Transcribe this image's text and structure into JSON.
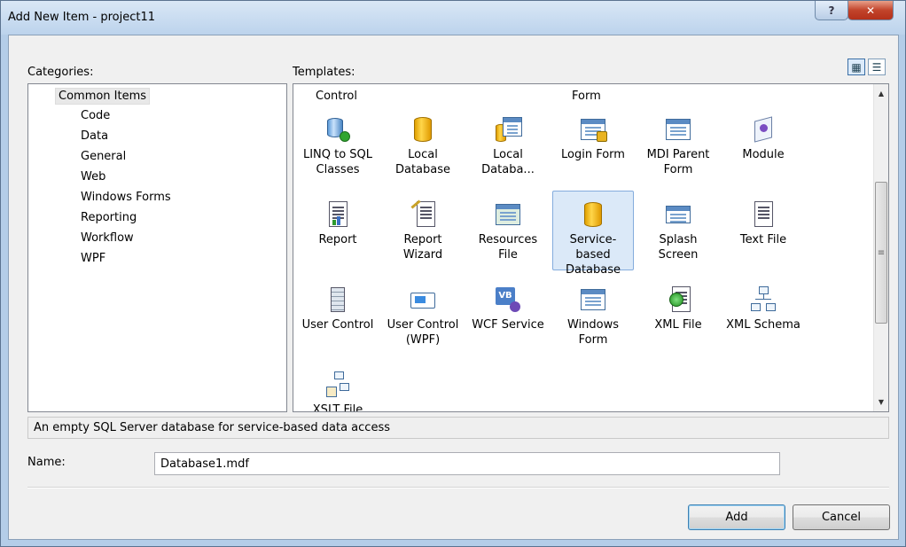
{
  "window": {
    "title": "Add New Item - project11",
    "help_label": "?",
    "close_label": "✕"
  },
  "categories": {
    "label": "Categories:",
    "root": "Common Items",
    "items": [
      "Code",
      "Data",
      "General",
      "Web",
      "Windows Forms",
      "Reporting",
      "Workflow",
      "WPF"
    ]
  },
  "templates": {
    "label": "Templates:",
    "view_large_icon": "▦",
    "view_small_icon": "☰",
    "header_control": "Control",
    "header_form": "Form",
    "items": [
      {
        "label": "LINQ to SQL Classes",
        "icon": "linq-to-sql-icon"
      },
      {
        "label": "Local Database",
        "icon": "database-icon"
      },
      {
        "label": "Local Databa...",
        "icon": "dataset-icon"
      },
      {
        "label": "Login Form",
        "icon": "login-form-icon"
      },
      {
        "label": "MDI Parent Form",
        "icon": "mdi-form-icon"
      },
      {
        "label": "Module",
        "icon": "module-icon"
      },
      {
        "label": "Report",
        "icon": "report-icon"
      },
      {
        "label": "Report Wizard",
        "icon": "report-wizard-icon"
      },
      {
        "label": "Resources File",
        "icon": "resources-icon"
      },
      {
        "label": "Service-based Database",
        "icon": "database-icon",
        "selected": true
      },
      {
        "label": "Splash Screen",
        "icon": "splash-screen-icon"
      },
      {
        "label": "Text File",
        "icon": "text-file-icon"
      },
      {
        "label": "User Control",
        "icon": "user-control-icon"
      },
      {
        "label": "User Control (WPF)",
        "icon": "wpf-control-icon"
      },
      {
        "label": "WCF Service",
        "icon": "wcf-service-icon"
      },
      {
        "label": "Windows Form",
        "icon": "windows-form-icon"
      },
      {
        "label": "XML File",
        "icon": "xml-file-icon"
      },
      {
        "label": "XML Schema",
        "icon": "xml-schema-icon"
      },
      {
        "label": "XSLT File",
        "icon": "xslt-file-icon"
      }
    ]
  },
  "description": "An empty SQL Server database for service-based data access",
  "name_field": {
    "label": "Name:",
    "value": "Database1.mdf"
  },
  "buttons": {
    "add": "Add",
    "cancel": "Cancel"
  },
  "colors": {
    "selection_bg": "#dbe9f8",
    "selection_border": "#84acdd",
    "db_gold": "#ffd64a"
  }
}
